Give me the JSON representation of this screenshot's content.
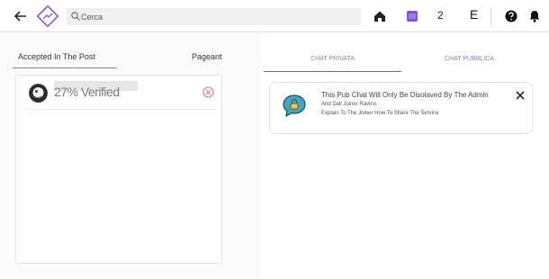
{
  "header": {
    "search_placeholder": "Cerca",
    "notification_count": "2",
    "e_label": "E"
  },
  "left": {
    "tab_accepted": "Accepted In The Post",
    "tab_pageant": "Pageant",
    "member": {
      "status": "27% Verified"
    }
  },
  "right": {
    "tab_private": "CHAT PRIVATA",
    "tab_public": "CHAT PUBBLICA",
    "card": {
      "line1": "This Pub Chat Will Only Be Disolaved By The Admin",
      "line2": "And Dall Joiner Ravino.",
      "line3": "Explain To The Joiner How To Share The Service"
    }
  },
  "colors": {
    "accent": "#7a5cc7",
    "chat_icon": "#7b57e0",
    "remove_icon": "#e07070",
    "bubble": "#3fa6c8"
  },
  "icons": [
    "back-arrow-icon",
    "logo-icon",
    "search-icon",
    "home-icon",
    "chat-icon",
    "help-icon",
    "bell-icon",
    "remove-icon",
    "lock-chat-icon",
    "close-icon"
  ]
}
